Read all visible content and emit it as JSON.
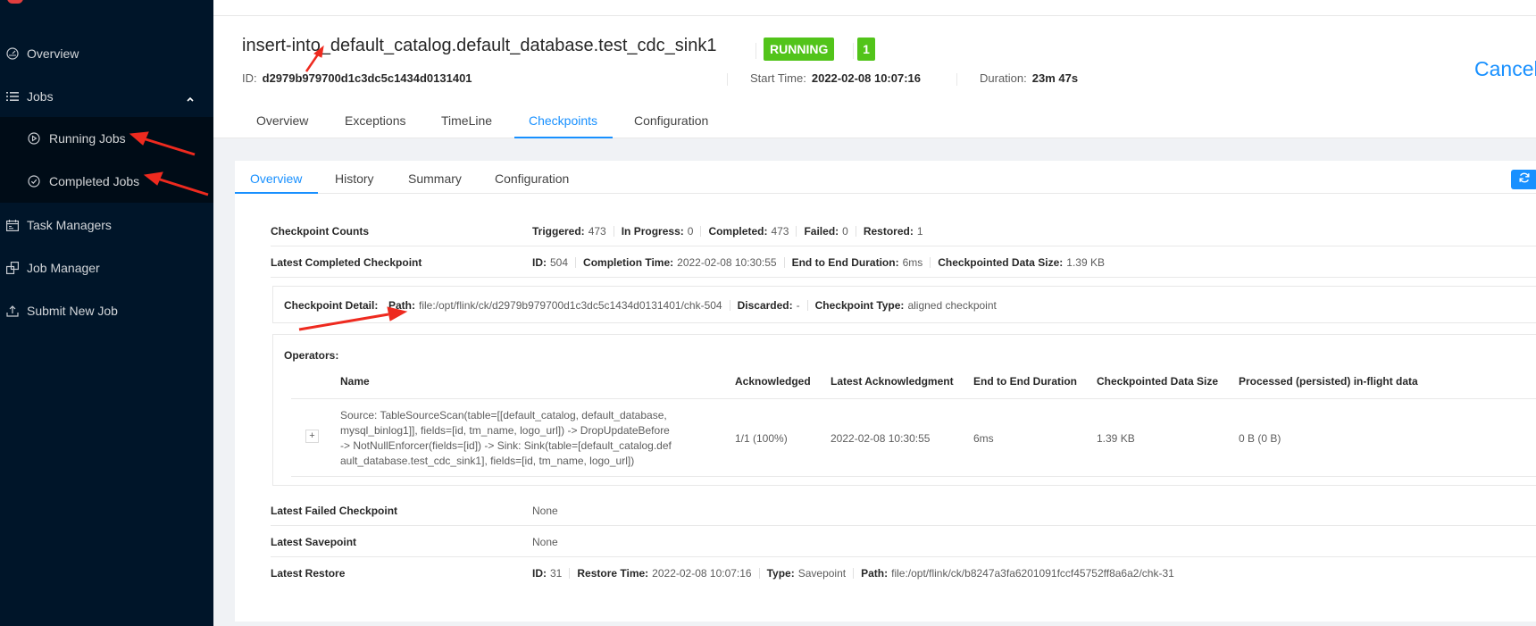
{
  "sidebar": {
    "items": [
      {
        "label": "Overview",
        "icon": "dashboard-icon"
      },
      {
        "label": "Jobs",
        "icon": "list-icon"
      },
      {
        "label": "Task Managers",
        "icon": "schedule-icon"
      },
      {
        "label": "Job Manager",
        "icon": "build-icon"
      },
      {
        "label": "Submit New Job",
        "icon": "upload-icon"
      }
    ],
    "subitems": [
      {
        "label": "Running Jobs",
        "icon": "play-circle-icon"
      },
      {
        "label": "Completed Jobs",
        "icon": "check-circle-icon"
      }
    ]
  },
  "header": {
    "title": "insert-into_default_catalog.default_database.test_cdc_sink1",
    "status": "RUNNING",
    "count": "1",
    "id_label": "ID:",
    "id_value": "d2979b979700d1c3dc5c1434d0131401",
    "start_label": "Start Time:",
    "start_value": "2022-02-08 10:07:16",
    "duration_label": "Duration:",
    "duration_value": "23m 47s",
    "cancel_label": "Cancel",
    "tabs": [
      "Overview",
      "Exceptions",
      "TimeLine",
      "Checkpoints",
      "Configuration"
    ]
  },
  "checkpoints": {
    "subtabs": [
      "Overview",
      "History",
      "Summary",
      "Configuration"
    ],
    "counts": {
      "label": "Checkpoint Counts",
      "triggered_label": "Triggered:",
      "triggered": "473",
      "in_progress_label": "In Progress:",
      "in_progress": "0",
      "completed_label": "Completed:",
      "completed": "473",
      "failed_label": "Failed:",
      "failed": "0",
      "restored_label": "Restored:",
      "restored": "1"
    },
    "latest_completed": {
      "label": "Latest Completed Checkpoint",
      "id_label": "ID:",
      "id": "504",
      "time_label": "Completion Time:",
      "time": "2022-02-08 10:30:55",
      "e2e_label": "End to End Duration:",
      "e2e": "6ms",
      "size_label": "Checkpointed Data Size:",
      "size": "1.39 KB"
    },
    "detail": {
      "label": "Checkpoint Detail:",
      "path_label": "Path:",
      "path": "file:/opt/flink/ck/d2979b979700d1c3dc5c1434d0131401/chk-504",
      "discarded_label": "Discarded:",
      "discarded": "-",
      "type_label": "Checkpoint Type:",
      "type": "aligned checkpoint"
    },
    "operators": {
      "label": "Operators:",
      "columns": [
        "Name",
        "Acknowledged",
        "Latest Acknowledgment",
        "End to End Duration",
        "Checkpointed Data Size",
        "Processed (persisted) in-flight data"
      ],
      "rows": [
        {
          "expand": "+",
          "name": "Source: TableSourceScan(table=[[default_catalog, default_database, mysql_binlog1]], fields=[id, tm_name, logo_url]) -> DropUpdateBefore -> NotNullEnforcer(fields=[id]) -> Sink: Sink(table=[default_catalog.default_database.test_cdc_sink1], fields=[id, tm_name, logo_url])",
          "acknowledged": "1/1 (100%)",
          "latest_ack": "2022-02-08 10:30:55",
          "e2e": "6ms",
          "size": "1.39 KB",
          "inflight": "0 B (0 B)"
        }
      ]
    },
    "latest_failed": {
      "label": "Latest Failed Checkpoint",
      "value": "None"
    },
    "latest_savepoint": {
      "label": "Latest Savepoint",
      "value": "None"
    },
    "latest_restore": {
      "label": "Latest Restore",
      "id_label": "ID:",
      "id": "31",
      "time_label": "Restore Time:",
      "time": "2022-02-08 10:07:16",
      "type_label": "Type:",
      "type": "Savepoint",
      "path_label": "Path:",
      "path": "file:/opt/flink/ck/b8247a3fa6201091fccf45752ff8a6a2/chk-31"
    }
  },
  "colors": {
    "sidebar_bg": "#001529",
    "submenu_bg": "#000c17",
    "accent": "#1890ff",
    "running_green": "#52c41a",
    "annotation_red": "#ee2a1f"
  }
}
